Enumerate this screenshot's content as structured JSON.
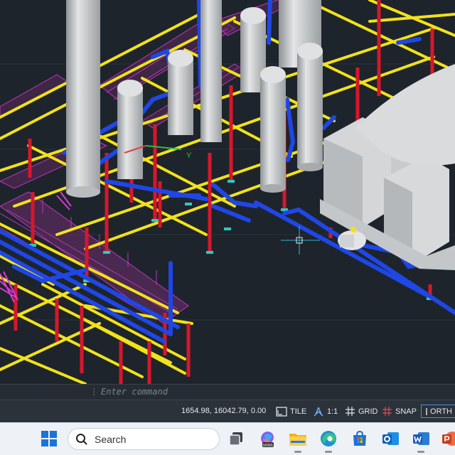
{
  "command_line": {
    "placeholder": "Enter command",
    "grip": "⋮"
  },
  "status_bar": {
    "coordinates": "1654.98, 16042.79, 0.00",
    "tile_label": "TILE",
    "scale_label": "1:1",
    "grid_label": "GRID",
    "snap_label": "SNAP",
    "ortho_label": "ORTH"
  },
  "taskbar": {
    "search_label": "Search",
    "m365_label": "M365",
    "apps": [
      "windows-start",
      "search",
      "task-view",
      "microsoft-365-copilot",
      "file-explorer",
      "edge",
      "microsoft-store",
      "outlook",
      "word",
      "powerpoint"
    ]
  },
  "colors": {
    "viewport_bg": "#1e242b",
    "steel_beam": "#f2e21a",
    "column": "#d6172c",
    "pipe": "#1f47e6",
    "walkway": "#d93ad6",
    "vessel": "#cfd2d4",
    "status_active": "#4f8fd6"
  }
}
